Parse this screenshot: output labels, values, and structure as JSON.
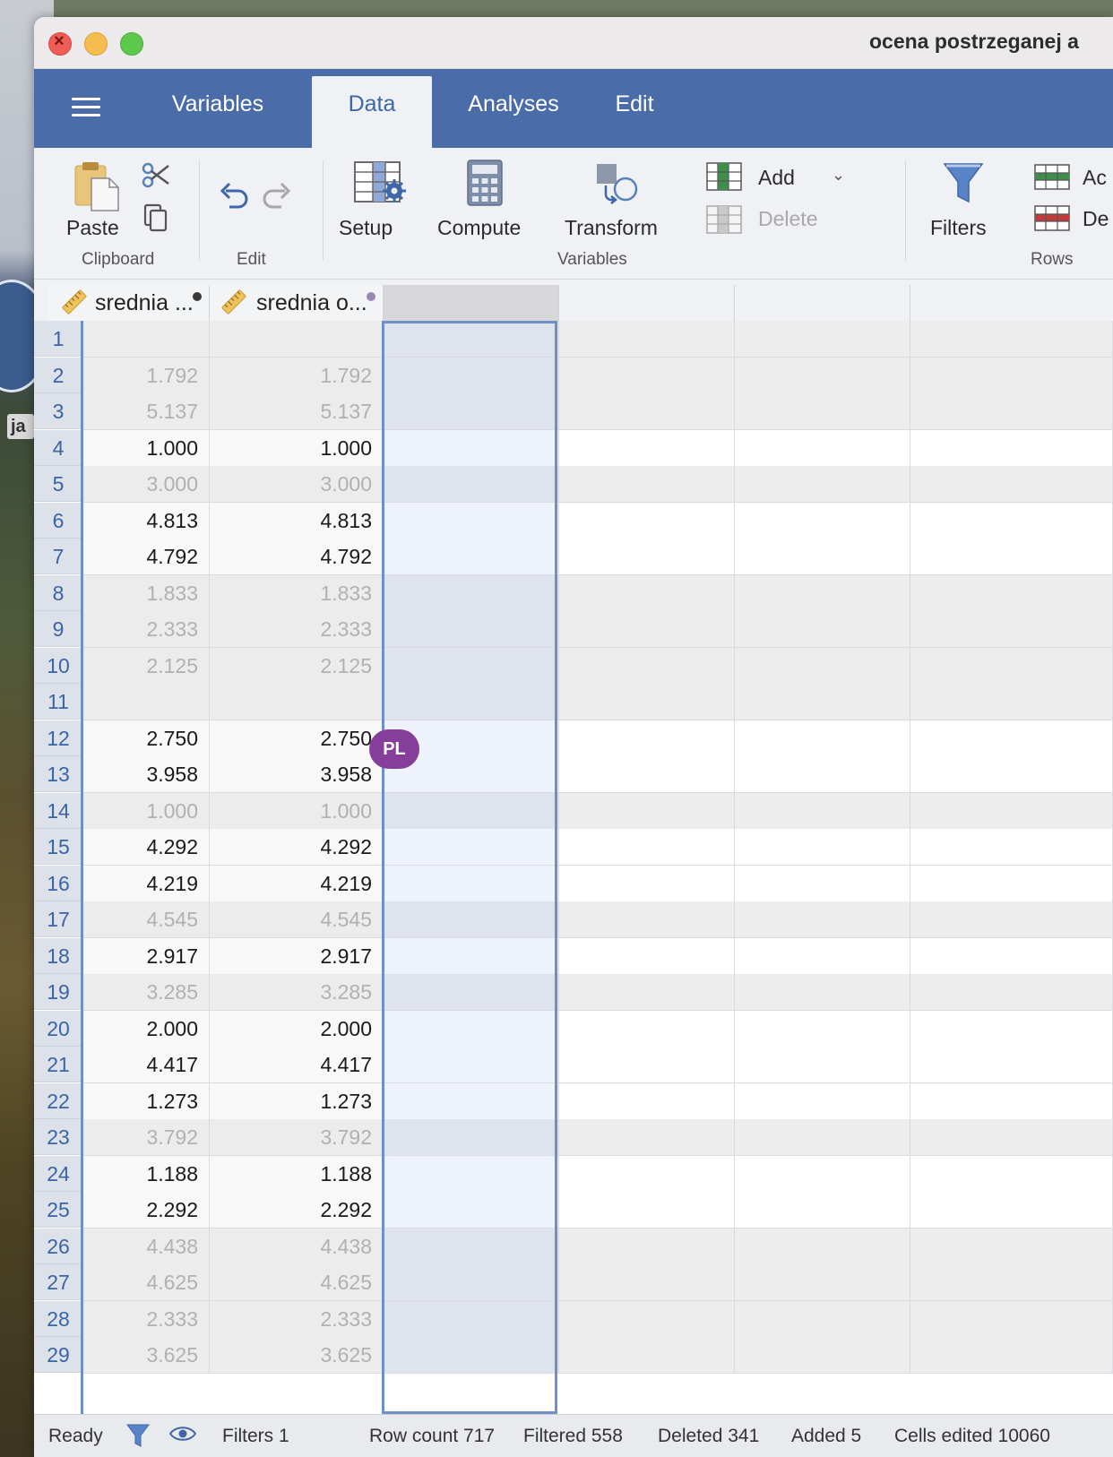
{
  "window": {
    "title": "ocena postrzeganej a"
  },
  "desktop": {
    "badge_text": "ja"
  },
  "tabs": [
    {
      "label": "Variables",
      "active": false
    },
    {
      "label": "Data",
      "active": true
    },
    {
      "label": "Analyses",
      "active": false
    },
    {
      "label": "Edit",
      "active": false
    }
  ],
  "ribbon": {
    "paste": "Paste",
    "clipboard_group": "Clipboard",
    "edit_group": "Edit",
    "setup": "Setup",
    "compute": "Compute",
    "transform": "Transform",
    "add": "Add",
    "delete": "Delete",
    "variables_group": "Variables",
    "filters": "Filters",
    "rows_add": "Ac",
    "rows_delete": "De",
    "rows_group": "Rows"
  },
  "columns": [
    {
      "name": "srednia ...",
      "dot_color": "#3a3a3a"
    },
    {
      "name": "srednia o...",
      "dot_color": "#9a86b8"
    }
  ],
  "rows": [
    {
      "n": "1",
      "a": "",
      "b": "",
      "filtered": true
    },
    {
      "n": "2",
      "a": "1.792",
      "b": "1.792",
      "filtered": true
    },
    {
      "n": "3",
      "a": "5.137",
      "b": "5.137",
      "filtered": true
    },
    {
      "n": "4",
      "a": "1.000",
      "b": "1.000",
      "filtered": false
    },
    {
      "n": "5",
      "a": "3.000",
      "b": "3.000",
      "filtered": true
    },
    {
      "n": "6",
      "a": "4.813",
      "b": "4.813",
      "filtered": false
    },
    {
      "n": "7",
      "a": "4.792",
      "b": "4.792",
      "filtered": false
    },
    {
      "n": "8",
      "a": "1.833",
      "b": "1.833",
      "filtered": true
    },
    {
      "n": "9",
      "a": "2.333",
      "b": "2.333",
      "filtered": true
    },
    {
      "n": "10",
      "a": "2.125",
      "b": "2.125",
      "filtered": true
    },
    {
      "n": "11",
      "a": "",
      "b": "",
      "filtered": true
    },
    {
      "n": "12",
      "a": "2.750",
      "b": "2.750",
      "filtered": false
    },
    {
      "n": "13",
      "a": "3.958",
      "b": "3.958",
      "filtered": false
    },
    {
      "n": "14",
      "a": "1.000",
      "b": "1.000",
      "filtered": true
    },
    {
      "n": "15",
      "a": "4.292",
      "b": "4.292",
      "filtered": false
    },
    {
      "n": "16",
      "a": "4.219",
      "b": "4.219",
      "filtered": false
    },
    {
      "n": "17",
      "a": "4.545",
      "b": "4.545",
      "filtered": true
    },
    {
      "n": "18",
      "a": "2.917",
      "b": "2.917",
      "filtered": false
    },
    {
      "n": "19",
      "a": "3.285",
      "b": "3.285",
      "filtered": true
    },
    {
      "n": "20",
      "a": "2.000",
      "b": "2.000",
      "filtered": false
    },
    {
      "n": "21",
      "a": "4.417",
      "b": "4.417",
      "filtered": false
    },
    {
      "n": "22",
      "a": "1.273",
      "b": "1.273",
      "filtered": false
    },
    {
      "n": "23",
      "a": "3.792",
      "b": "3.792",
      "filtered": true
    },
    {
      "n": "24",
      "a": "1.188",
      "b": "1.188",
      "filtered": false
    },
    {
      "n": "25",
      "a": "2.292",
      "b": "2.292",
      "filtered": false
    },
    {
      "n": "26",
      "a": "4.438",
      "b": "4.438",
      "filtered": true
    },
    {
      "n": "27",
      "a": "4.625",
      "b": "4.625",
      "filtered": true
    },
    {
      "n": "28",
      "a": "2.333",
      "b": "2.333",
      "filtered": true
    },
    {
      "n": "29",
      "a": "3.625",
      "b": "3.625",
      "filtered": true
    }
  ],
  "collaborator": {
    "initials": "PL",
    "color": "#863e9b"
  },
  "status": {
    "ready": "Ready",
    "filters": "Filters 1",
    "row_count": "Row count 717",
    "filtered": "Filtered 558",
    "deleted": "Deleted 341",
    "added": "Added 5",
    "cells_edited": "Cells edited 10060"
  },
  "colors": {
    "accent": "#4a6ca8",
    "row_number": "#3a64a6",
    "selection": "#6e8fc8"
  }
}
